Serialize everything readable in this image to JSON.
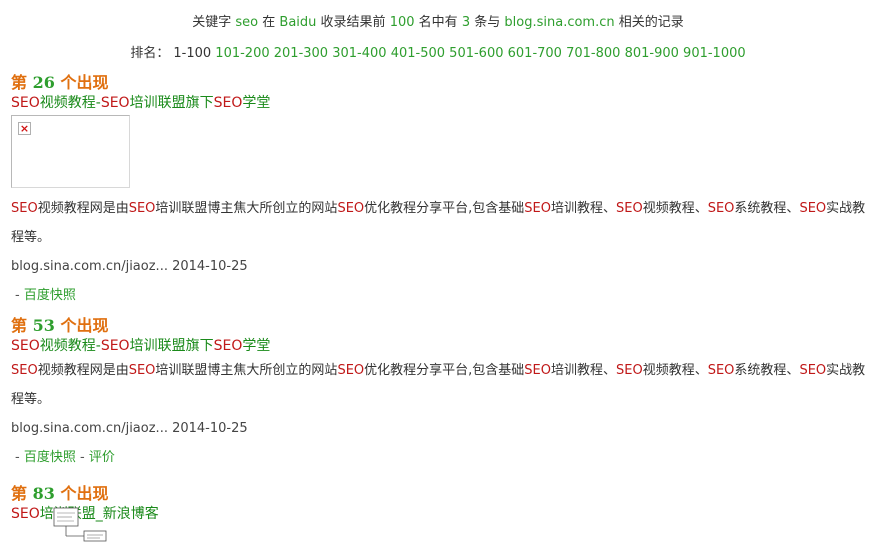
{
  "summary": {
    "prefix": "关键字",
    "keyword": "seo",
    "in": "在",
    "engine": "Baidu",
    "collect": "收录结果前",
    "top": "100",
    "middle": "名中有",
    "count": "3",
    "tiao": "条与",
    "domain": "blog.sina.com.cn",
    "suffix": "相关的记录"
  },
  "ranks": {
    "label": "排名：",
    "items": [
      "1-100",
      "101-200",
      "201-300",
      "301-400",
      "401-500",
      "501-600",
      "601-700",
      "701-800",
      "801-900",
      "901-1000"
    ]
  },
  "results": [
    {
      "heading_pre": "第",
      "rank": "26",
      "heading_post": "个出现",
      "title_parts": [
        "SEO",
        "视频教程-",
        "SEO",
        "培训联盟旗下",
        "SEO",
        "学堂"
      ],
      "has_thumb": true,
      "desc_parts": [
        "SEO",
        "视频教程网是由",
        "SEO",
        "培训联盟博主焦大所创立的网站",
        "SEO",
        "优化教程分享平台,包含基础",
        "SEO",
        "培训教程、",
        "SEO",
        "视频教程、",
        "SEO",
        "系统教程、",
        "SEO",
        "实战教程等。"
      ],
      "url": "blog.sina.com.cn/jiaoz...",
      "date": "2014-10-25",
      "dash": "-",
      "snapshot": "百度快照",
      "review": ""
    },
    {
      "heading_pre": "第",
      "rank": "53",
      "heading_post": "个出现",
      "title_parts": [
        "SEO",
        "视频教程-",
        "SEO",
        "培训联盟旗下",
        "SEO",
        "学堂"
      ],
      "has_thumb": false,
      "desc_parts": [
        "SEO",
        "视频教程网是由",
        "SEO",
        "培训联盟博主焦大所创立的网站",
        "SEO",
        "优化教程分享平台,包含基础",
        "SEO",
        "培训教程、",
        "SEO",
        "视频教程、",
        "SEO",
        "系统教程、",
        "SEO",
        "实战教程等。"
      ],
      "url": "blog.sina.com.cn/jiaoz...",
      "date": "2014-10-25",
      "dash": "-",
      "snapshot": "百度快照",
      "review_sep": "-",
      "review": "评价"
    },
    {
      "heading_pre": "第",
      "rank": "83",
      "heading_post": "个出现",
      "title_parts": [
        "SEO",
        "培训联盟_新浪博客"
      ]
    }
  ],
  "colors": {
    "link_green": "#2e9e2e",
    "highlight_red": "#c01818",
    "heading_orange": "#e07010"
  }
}
